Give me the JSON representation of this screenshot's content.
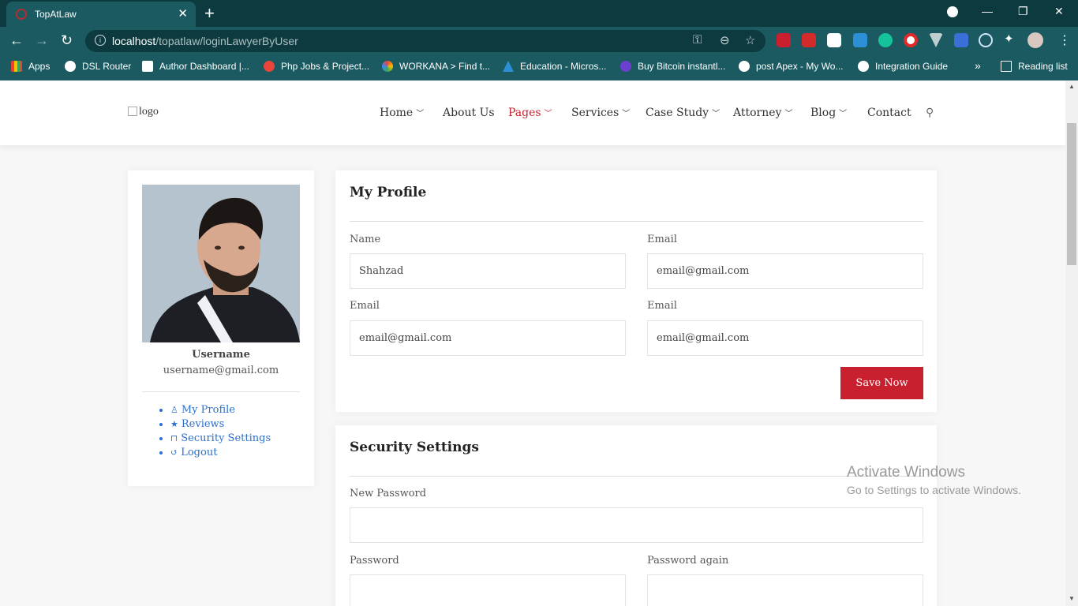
{
  "browser": {
    "tab_title": "TopAtLaw",
    "url_host": "localhost",
    "url_path": "/topatlaw/loginLawyerByUser",
    "bookmarks": [
      "Apps",
      "DSL Router",
      "Author Dashboard |...",
      "Php Jobs & Project...",
      "WORKANA > Find t...",
      "Education - Micros...",
      "Buy Bitcoin instantl...",
      "post Apex - My Wo...",
      "Integration Guide"
    ],
    "overflow": "»",
    "reading_list": "Reading list"
  },
  "header": {
    "logo_alt": "logo",
    "nav": [
      "Home",
      "About Us",
      "Pages",
      "Services",
      "Case Study",
      "Attorney",
      "Blog",
      "Contact"
    ]
  },
  "sidebar": {
    "username": "Username",
    "email": "username@gmail.com",
    "menu": [
      "My Profile",
      "Reviews",
      "Security Settings",
      "Logout"
    ]
  },
  "profile": {
    "title": "My Profile",
    "fields": [
      {
        "label": "Name",
        "value": "Shahzad"
      },
      {
        "label": "Email",
        "value": "email@gmail.com"
      },
      {
        "label": "Email",
        "value": "email@gmail.com"
      },
      {
        "label": "Email",
        "value": "email@gmail.com"
      }
    ],
    "save_label": "Save Now"
  },
  "security": {
    "title": "Security Settings",
    "new_password_label": "New Password",
    "password_label": "Password",
    "password_again_label": "Password again",
    "new_password_value": "",
    "password_value": "",
    "password_again_value": ""
  },
  "watermark": {
    "line1": "Activate Windows",
    "line2": "Go to Settings to activate Windows."
  },
  "colors": {
    "accent": "#c8202f",
    "link": "#2a6fd0",
    "chrome": "#1a5a60"
  }
}
